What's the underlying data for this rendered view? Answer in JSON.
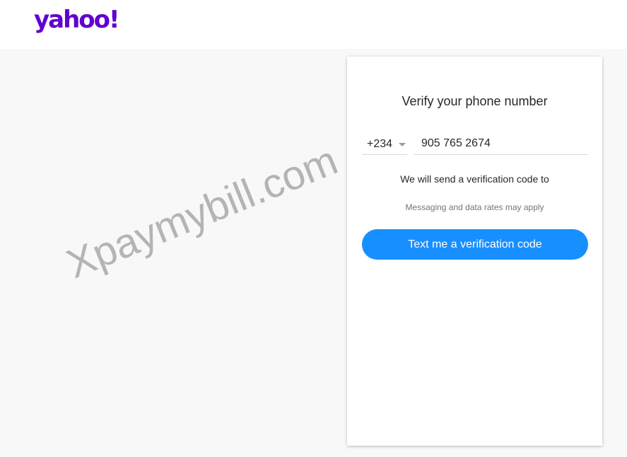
{
  "header": {
    "logo_text": "yahoo!"
  },
  "watermark": {
    "text": "Xpaymybill.com"
  },
  "verify": {
    "title": "Verify your phone number",
    "country_code": "+234",
    "phone_value": "905 765 2674",
    "send_text": "We will send a verification code to",
    "rates_text": "Messaging and data rates may apply",
    "button_label": "Text me a verification code"
  },
  "colors": {
    "brand": "#6001d2",
    "button": "#188fff",
    "page_bg": "#f8f8f8"
  }
}
